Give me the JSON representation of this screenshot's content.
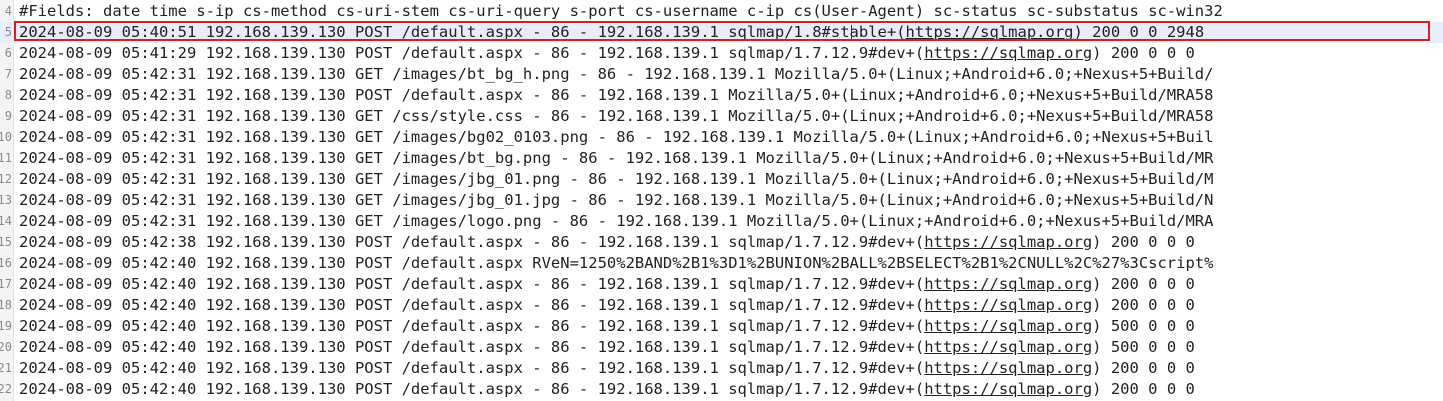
{
  "colors": {
    "highlight_border": "#d81e1e",
    "selected_line_bg": "#e8ecfb",
    "text": "#222222",
    "gutter": "#f4f4f4"
  },
  "lines": [
    {
      "num": "4",
      "parts": [
        {
          "t": "#Fields: date time s-ip cs-method cs-uri-stem cs-uri-query s-port cs-username c-ip cs(User-Agent) sc-status sc-substatus sc-win32"
        }
      ]
    },
    {
      "num": "5",
      "highlight": true,
      "parts": [
        {
          "t": "2024-08-09 05:40:51 192.168.139.130 POST /default.aspx - 86 - 192.168.139.1 sqlmap/1.8#stable+("
        },
        {
          "t": "https://sqlmap.org",
          "link": true
        },
        {
          "t": ") 200 0 0 2948"
        }
      ]
    },
    {
      "num": "6",
      "parts": [
        {
          "t": "2024-08-09 05:41:29 192.168.139.130 POST /default.aspx - 86 - 192.168.139.1 sqlmap/1.7.12.9#dev+("
        },
        {
          "t": "https://sqlmap.org",
          "link": true
        },
        {
          "t": ") 200 0 0 0"
        }
      ]
    },
    {
      "num": "7",
      "parts": [
        {
          "t": "2024-08-09 05:42:31 192.168.139.130 GET /images/bt_bg_h.png - 86 - 192.168.139.1 Mozilla/5.0+(Linux;+Android+6.0;+Nexus+5+Build/"
        }
      ]
    },
    {
      "num": "8",
      "parts": [
        {
          "t": "2024-08-09 05:42:31 192.168.139.130 POST /default.aspx - 86 - 192.168.139.1 Mozilla/5.0+(Linux;+Android+6.0;+Nexus+5+Build/MRA58"
        }
      ]
    },
    {
      "num": "9",
      "parts": [
        {
          "t": "2024-08-09 05:42:31 192.168.139.130 GET /css/style.css - 86 - 192.168.139.1 Mozilla/5.0+(Linux;+Android+6.0;+Nexus+5+Build/MRA58"
        }
      ]
    },
    {
      "num": "10",
      "parts": [
        {
          "t": "2024-08-09 05:42:31 192.168.139.130 GET /images/bg02_0103.png - 86 - 192.168.139.1 Mozilla/5.0+(Linux;+Android+6.0;+Nexus+5+Buil"
        }
      ]
    },
    {
      "num": "11",
      "parts": [
        {
          "t": "2024-08-09 05:42:31 192.168.139.130 GET /images/bt_bg.png - 86 - 192.168.139.1 Mozilla/5.0+(Linux;+Android+6.0;+Nexus+5+Build/MR"
        }
      ]
    },
    {
      "num": "12",
      "parts": [
        {
          "t": "2024-08-09 05:42:31 192.168.139.130 GET /images/jbg_01.png - 86 - 192.168.139.1 Mozilla/5.0+(Linux;+Android+6.0;+Nexus+5+Build/M"
        }
      ]
    },
    {
      "num": "13",
      "parts": [
        {
          "t": "2024-08-09 05:42:31 192.168.139.130 GET /images/jbg_01.jpg - 86 - 192.168.139.1 Mozilla/5.0+(Linux;+Android+6.0;+Nexus+5+Build/N"
        }
      ]
    },
    {
      "num": "14",
      "parts": [
        {
          "t": "2024-08-09 05:42:31 192.168.139.130 GET /images/logo.png - 86 - 192.168.139.1 Mozilla/5.0+(Linux;+Android+6.0;+Nexus+5+Build/MRA"
        }
      ]
    },
    {
      "num": "15",
      "parts": [
        {
          "t": "2024-08-09 05:42:38 192.168.139.130 POST /default.aspx - 86 - 192.168.139.1 sqlmap/1.7.12.9#dev+("
        },
        {
          "t": "https://sqlmap.org",
          "link": true
        },
        {
          "t": ") 200 0 0 0"
        }
      ]
    },
    {
      "num": "16",
      "parts": [
        {
          "t": "2024-08-09 05:42:40 192.168.139.130 POST /default.aspx RVeN=1250%2BAND%2B1%3D1%2BUNION%2BALL%2BSELECT%2B1%2CNULL%2C%27%3Cscript%"
        }
      ]
    },
    {
      "num": "17",
      "parts": [
        {
          "t": "2024-08-09 05:42:40 192.168.139.130 POST /default.aspx - 86 - 192.168.139.1 sqlmap/1.7.12.9#dev+("
        },
        {
          "t": "https://sqlmap.org",
          "link": true
        },
        {
          "t": ") 200 0 0 0"
        }
      ]
    },
    {
      "num": "18",
      "parts": [
        {
          "t": "2024-08-09 05:42:40 192.168.139.130 POST /default.aspx - 86 - 192.168.139.1 sqlmap/1.7.12.9#dev+("
        },
        {
          "t": "https://sqlmap.org",
          "link": true
        },
        {
          "t": ") 200 0 0 0"
        }
      ]
    },
    {
      "num": "19",
      "parts": [
        {
          "t": "2024-08-09 05:42:40 192.168.139.130 POST /default.aspx - 86 - 192.168.139.1 sqlmap/1.7.12.9#dev+("
        },
        {
          "t": "https://sqlmap.org",
          "link": true
        },
        {
          "t": ") 500 0 0 0"
        }
      ]
    },
    {
      "num": "20",
      "parts": [
        {
          "t": "2024-08-09 05:42:40 192.168.139.130 POST /default.aspx - 86 - 192.168.139.1 sqlmap/1.7.12.9#dev+("
        },
        {
          "t": "https://sqlmap.org",
          "link": true
        },
        {
          "t": ") 500 0 0 0"
        }
      ]
    },
    {
      "num": "21",
      "parts": [
        {
          "t": "2024-08-09 05:42:40 192.168.139.130 POST /default.aspx - 86 - 192.168.139.1 sqlmap/1.7.12.9#dev+("
        },
        {
          "t": "https://sqlmap.org",
          "link": true
        },
        {
          "t": ") 200 0 0 0"
        }
      ]
    },
    {
      "num": "22",
      "parts": [
        {
          "t": "2024-08-09 05:42:40 192.168.139.130 POST /default.aspx - 86 - 192.168.139.1 sqlmap/1.7.12.9#dev+("
        },
        {
          "t": "https://sqlmap.org",
          "link": true
        },
        {
          "t": ") 200 0 0 0"
        }
      ]
    }
  ]
}
